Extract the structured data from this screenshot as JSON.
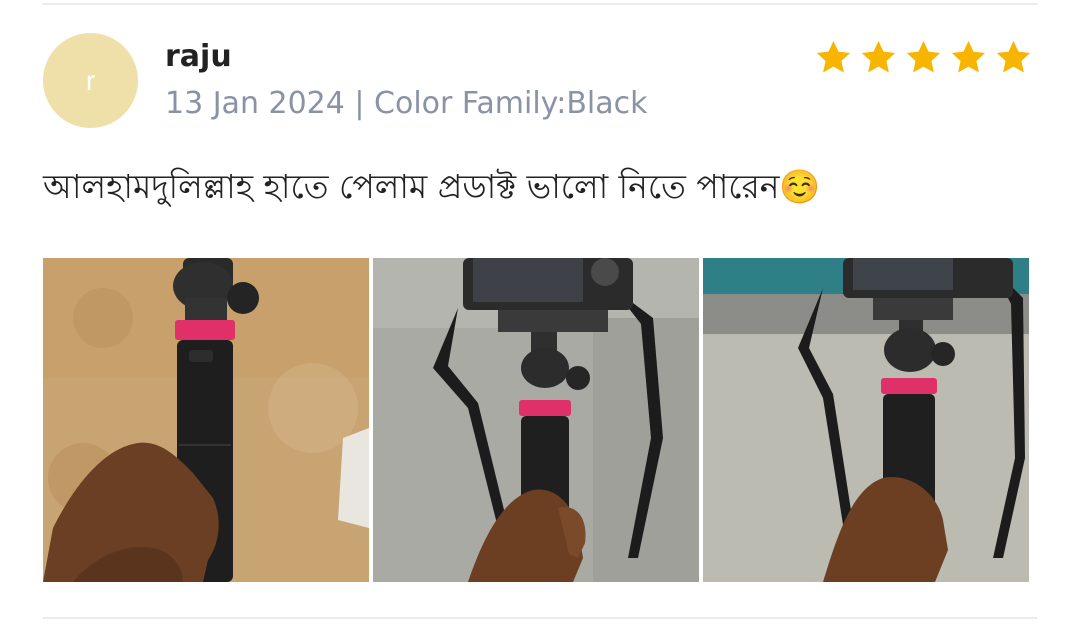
{
  "review": {
    "avatar_letter": "r",
    "reviewer_name": "raju",
    "meta": "13 Jan 2024 | Color Family:Black",
    "rating": 5,
    "rating_color": "#f7b500",
    "text": "আলহামদুলিল্লাহ হাতে পেলাম প্রডাক্ট ভালো নিতে পারেন☺️"
  },
  "colors": {
    "avatar_bg": "#efdfa8",
    "name": "#222222",
    "meta": "#8a93a6",
    "divider": "#ebebeb"
  },
  "photos": [
    {
      "name": "review-photo-1"
    },
    {
      "name": "review-photo-2"
    },
    {
      "name": "review-photo-3"
    }
  ]
}
